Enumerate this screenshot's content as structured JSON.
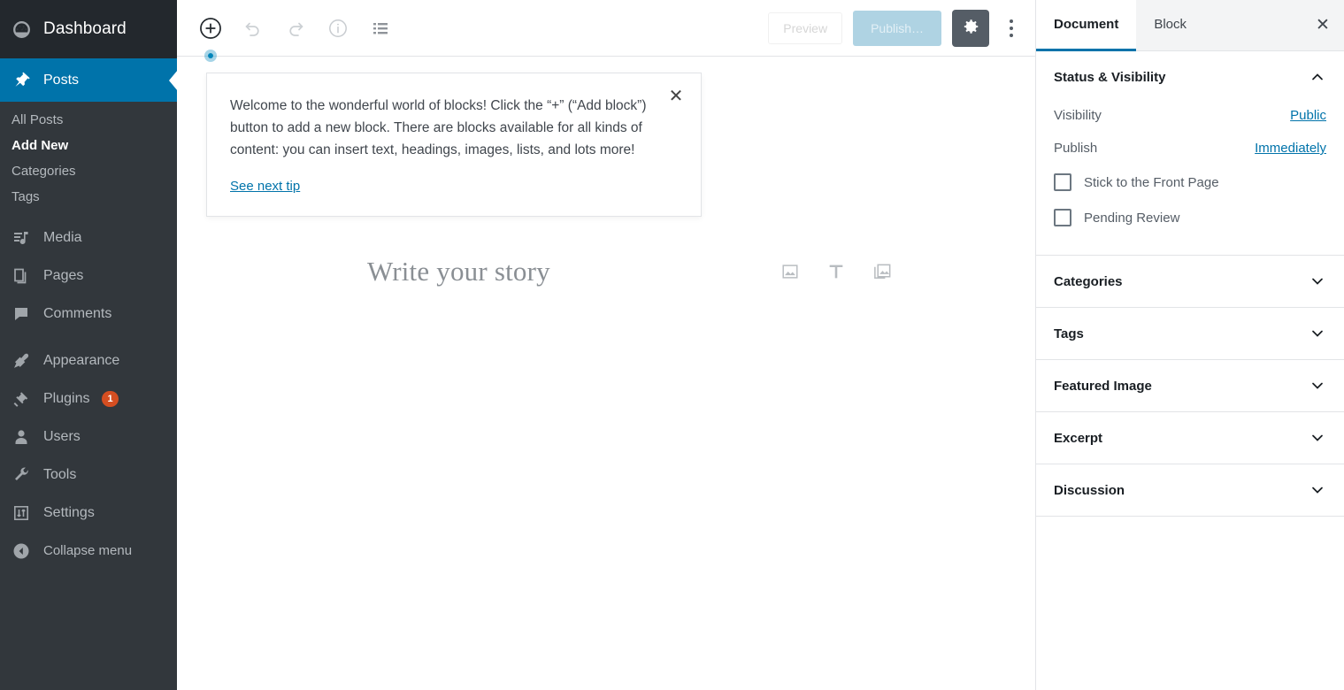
{
  "sidebar": {
    "top": {
      "label": "Dashboard",
      "icon": "dashboard-icon"
    },
    "items": [
      {
        "label": "Posts",
        "icon": "pin-icon",
        "active": true
      },
      {
        "label": "Media",
        "icon": "media-icon"
      },
      {
        "label": "Pages",
        "icon": "pages-icon"
      },
      {
        "label": "Comments",
        "icon": "comments-icon"
      },
      {
        "label": "Appearance",
        "icon": "appearance-icon"
      },
      {
        "label": "Plugins",
        "icon": "plugins-icon",
        "badge": "1"
      },
      {
        "label": "Users",
        "icon": "users-icon"
      },
      {
        "label": "Tools",
        "icon": "tools-icon"
      },
      {
        "label": "Settings",
        "icon": "settings-icon"
      }
    ],
    "submenu": [
      {
        "label": "All Posts",
        "current": false
      },
      {
        "label": "Add New",
        "current": true
      },
      {
        "label": "Categories",
        "current": false
      },
      {
        "label": "Tags",
        "current": false
      }
    ],
    "collapse": {
      "label": "Collapse menu",
      "icon": "collapse-arrow-icon"
    },
    "colors": {
      "background": "#32373c",
      "top_background": "#23282d",
      "active": "#0073aa",
      "badge": "#d54e21"
    }
  },
  "toolbar": {
    "add_block_label": "Add block",
    "undo_label": "Undo",
    "redo_label": "Redo",
    "info_label": "Content structure",
    "block_nav_label": "Block navigation",
    "preview_label": "Preview",
    "publish_label": "Publish…",
    "settings_label": "Settings",
    "more_label": "More tools & options"
  },
  "tip": {
    "text": "Welcome to the wonderful world of blocks! Click the “+” (“Add block”) button to add a new block. There are blocks available for all kinds of content: you can insert text, headings, images, lists, and lots more!",
    "link": "See next tip",
    "close_label": "Dismiss this notice"
  },
  "editor": {
    "title_placeholder": "Write your story",
    "quick_inserts": [
      {
        "name": "image-icon",
        "label": "Image"
      },
      {
        "name": "paragraph-icon",
        "label": "Paragraph"
      },
      {
        "name": "gallery-icon",
        "label": "Gallery"
      }
    ]
  },
  "settings": {
    "tabs": [
      {
        "label": "Document",
        "active": true
      },
      {
        "label": "Block",
        "active": false
      }
    ],
    "close_label": "Close settings",
    "panels": [
      {
        "title": "Status & Visibility",
        "open": true,
        "rows": [
          {
            "label": "Visibility",
            "value": "Public"
          },
          {
            "label": "Publish",
            "value": "Immediately"
          }
        ],
        "checkboxes": [
          {
            "label": "Stick to the Front Page",
            "checked": false
          },
          {
            "label": "Pending Review",
            "checked": false
          }
        ]
      },
      {
        "title": "Categories",
        "open": false
      },
      {
        "title": "Tags",
        "open": false
      },
      {
        "title": "Featured Image",
        "open": false
      },
      {
        "title": "Excerpt",
        "open": false
      },
      {
        "title": "Discussion",
        "open": false
      }
    ]
  },
  "colors": {
    "accent": "#0073aa",
    "link": "#0073aa",
    "publish_disabled": "#afd3e3",
    "gear_background": "#555d66"
  }
}
